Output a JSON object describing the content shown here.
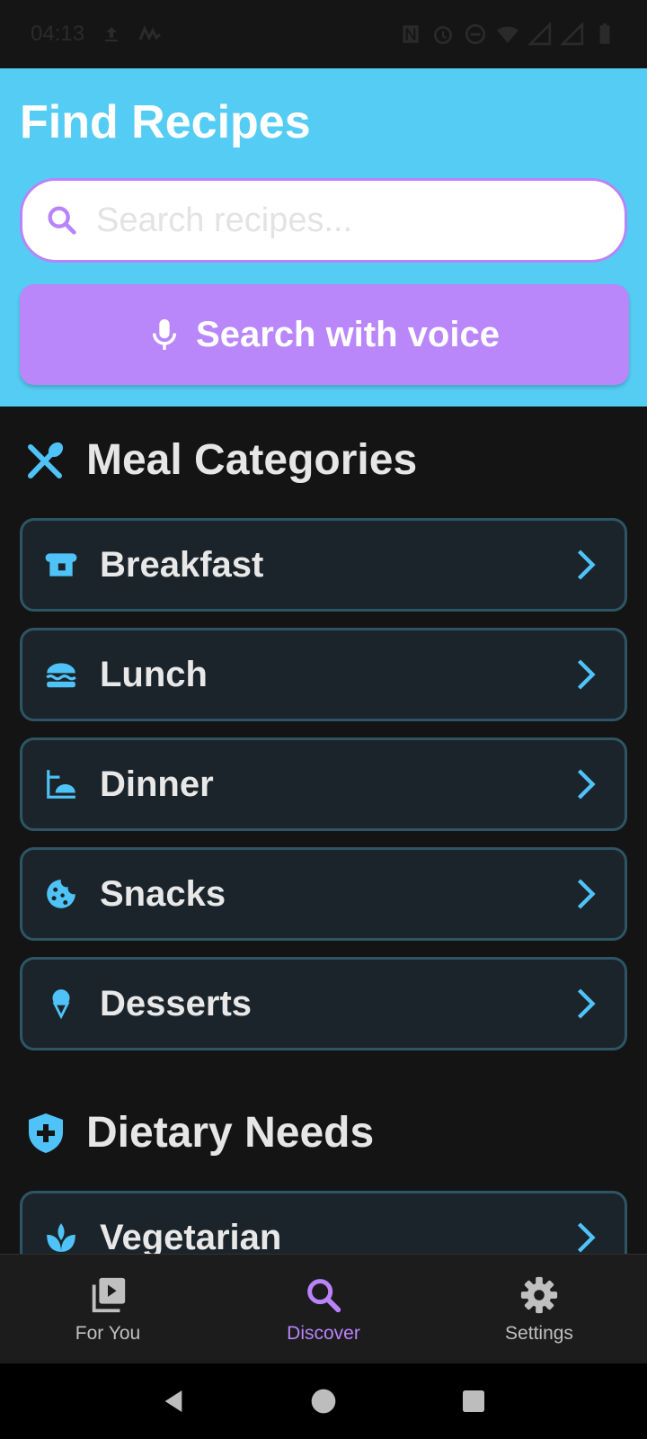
{
  "statusbar": {
    "time": "04:13"
  },
  "header": {
    "title": "Find Recipes",
    "search_placeholder": "Search recipes...",
    "voice_button_label": "Search with voice"
  },
  "meal_categories": {
    "title": "Meal Categories",
    "items": [
      {
        "label": "Breakfast",
        "icon": "bread-icon"
      },
      {
        "label": "Lunch",
        "icon": "burger-icon"
      },
      {
        "label": "Dinner",
        "icon": "dinner-icon"
      },
      {
        "label": "Snacks",
        "icon": "cookie-icon"
      },
      {
        "label": "Desserts",
        "icon": "icecream-icon"
      }
    ]
  },
  "dietary_needs": {
    "title": "Dietary Needs",
    "items": [
      {
        "label": "Vegetarian",
        "icon": "leaf-icon"
      }
    ]
  },
  "bottom_nav": {
    "items": [
      {
        "label": "For You",
        "icon": "video-library-icon"
      },
      {
        "label": "Discover",
        "icon": "search-icon",
        "active": true
      },
      {
        "label": "Settings",
        "icon": "gear-icon"
      }
    ]
  },
  "colors": {
    "header_bg": "#55ccf3",
    "accent_purple": "#b983fa",
    "card_bg": "#1b242a",
    "card_border": "#2d5566",
    "icon_blue": "#4fc3f7"
  }
}
